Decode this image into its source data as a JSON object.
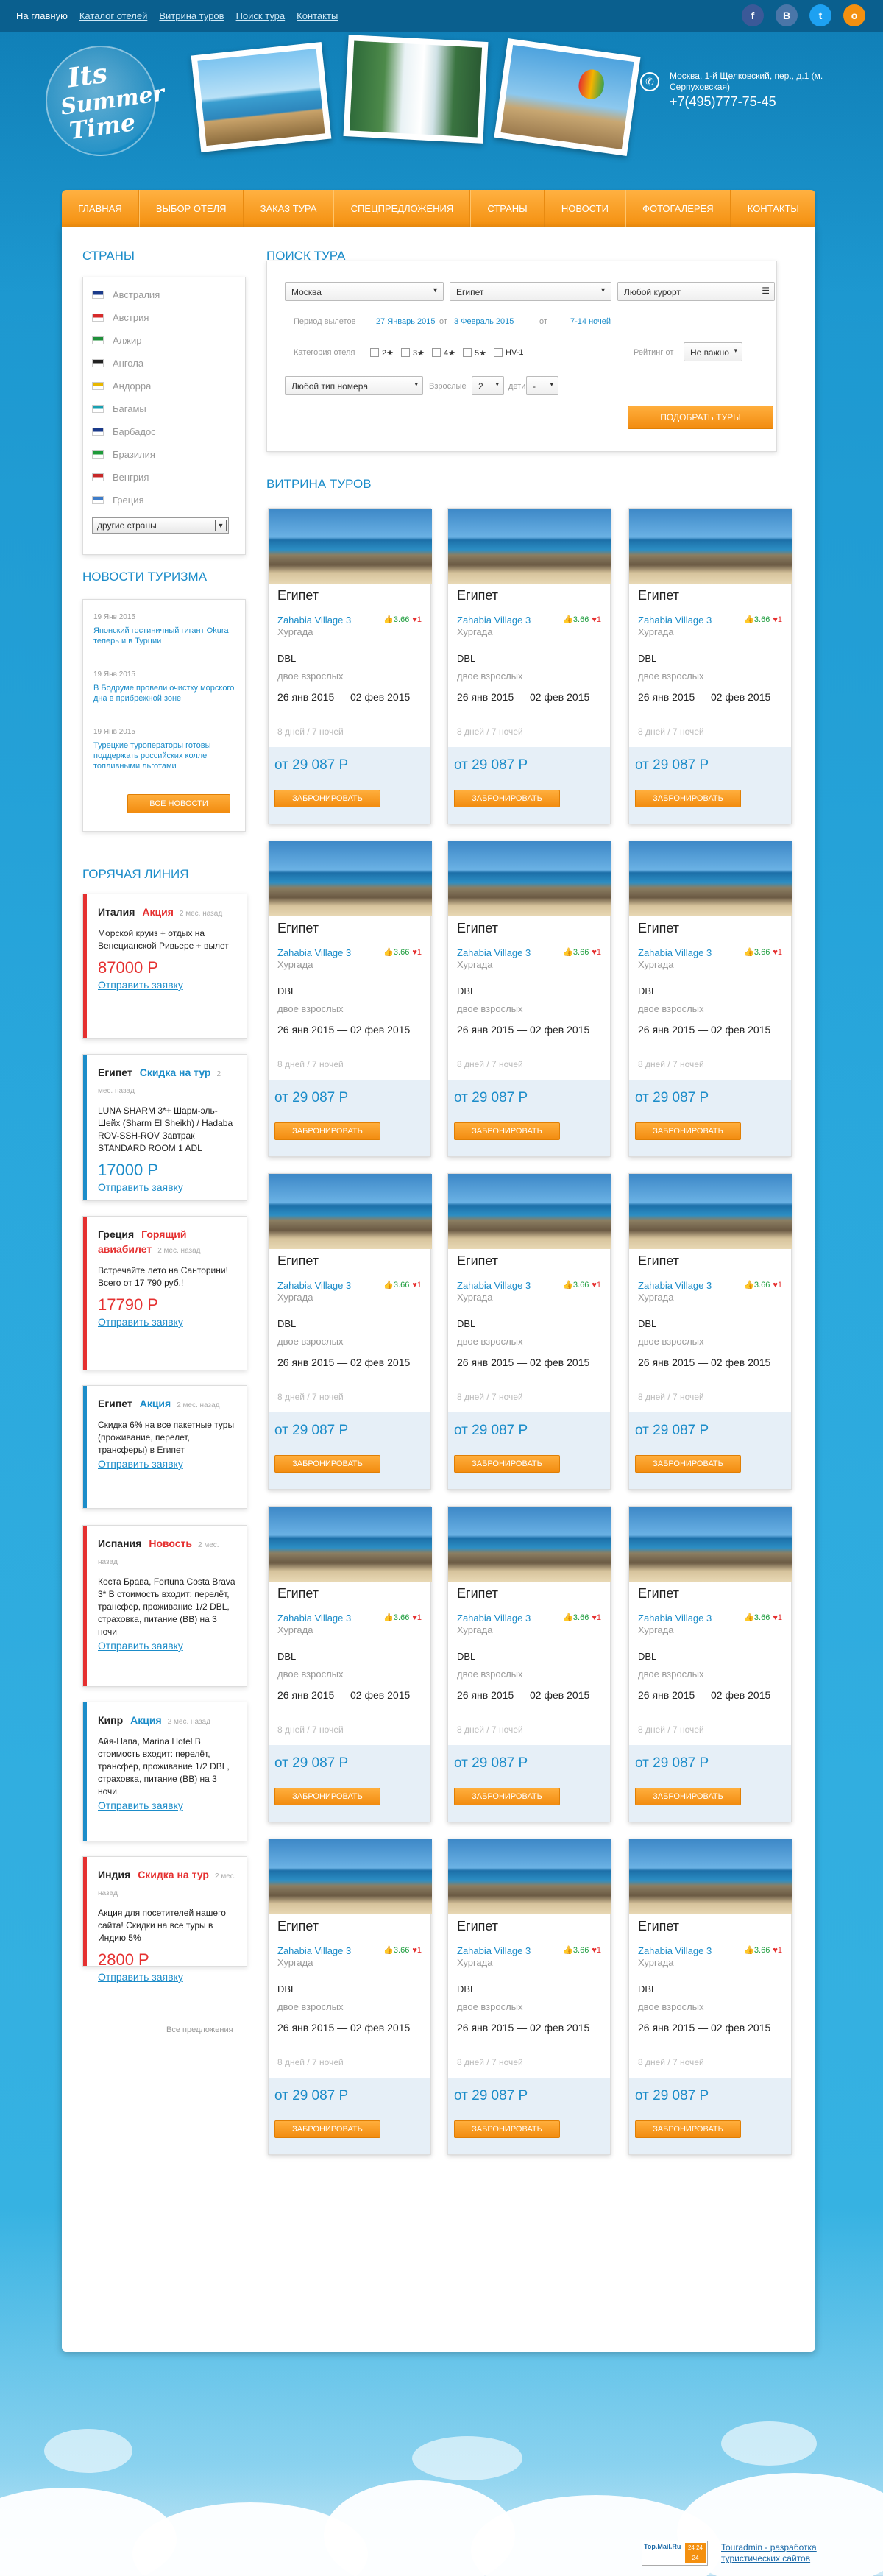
{
  "topnav": [
    "На главную",
    "Каталог отелей",
    "Витрина туров",
    "Поиск тура",
    "Контакты"
  ],
  "social": [
    {
      "label": "f",
      "color": "#3b5998",
      "name": "facebook-icon"
    },
    {
      "label": "В",
      "color": "#4a76a8",
      "name": "vk-icon"
    },
    {
      "label": "t",
      "color": "#1da1f2",
      "name": "twitter-icon"
    },
    {
      "label": "о",
      "color": "#f4900f",
      "name": "odnoklassniki-icon"
    }
  ],
  "logo": {
    "l1": "Its",
    "l2": "Summer",
    "l3": "Time"
  },
  "contact": {
    "address": "Москва, 1-й Щелковский, пер., д.1 (м. Серпуховская)",
    "phone": "+7(495)777-75-45"
  },
  "mainnav": [
    "Главная",
    "Выбор отеля",
    "Заказ тура",
    "Спецпредложения",
    "Страны",
    "Новости",
    "Фотогалерея",
    "Контакты"
  ],
  "countries_title": "Страны",
  "countries": [
    {
      "name": "Австралия",
      "flag": "#1a3a8a"
    },
    {
      "name": "Австрия",
      "flag": "#d62a2a"
    },
    {
      "name": "Алжир",
      "flag": "#1f8f3a"
    },
    {
      "name": "Ангола",
      "flag": "#222222"
    },
    {
      "name": "Андорра",
      "flag": "#e8b700"
    },
    {
      "name": "Багамы",
      "flag": "#18a0b0"
    },
    {
      "name": "Барбадос",
      "flag": "#1a3a8a"
    },
    {
      "name": "Бразилия",
      "flag": "#1f9a3a"
    },
    {
      "name": "Венгрия",
      "flag": "#c62828"
    },
    {
      "name": "Греция",
      "flag": "#3d7cc9"
    }
  ],
  "other_countries": "другие страны",
  "news_title": "Новости туризма",
  "news": [
    {
      "date": "19 Янв 2015",
      "text": "Японский гостиничный гигант Okura теперь и в Турции"
    },
    {
      "date": "19 Янв 2015",
      "text": "В Бодруме провели очистку морского дна в прибрежной зоне"
    },
    {
      "date": "19 Янв 2015",
      "text": "Турецкие туроператоры готовы поддержать российских коллег топливными льготами"
    }
  ],
  "all_news": "Все новости",
  "hotline_title": "Горячая линия",
  "hotline": [
    {
      "country": "Италия",
      "tag": "Акция",
      "tag_color": "#e53030",
      "ago": "2 мес. назад",
      "text": "Морской круиз + отдых на Венецианской Ривьере + вылет",
      "price": "87000 Р",
      "price_color": "#e53030",
      "bar": "#e53030"
    },
    {
      "country": "Египет",
      "tag": "Скидка на тур",
      "tag_color": "#1b8cc9",
      "ago": "2 мес. назад",
      "text": "LUNA SHARM 3*+ Шарм-эль-Шейх (Sharm El Sheikh) / Hadaba ROV-SSH-ROV Завтрак STANDARD ROOM 1 ADL",
      "price": "17000 Р",
      "price_color": "#1b8cc9",
      "bar": "#1b8cc9"
    },
    {
      "country": "Греция",
      "tag": "Горящий авиабилет",
      "tag_color": "#e53030",
      "ago": "2 мес. назад",
      "text": "Встречайте лето на Санторини! Всего от 17 790 руб.!",
      "price": "17790 Р",
      "price_color": "#e53030",
      "bar": "#e53030"
    },
    {
      "country": "Египет",
      "tag": "Акция",
      "tag_color": "#1b8cc9",
      "ago": "2 мес. назад",
      "text": "Скидка 6% на все пакетные туры (проживание, перелет, трансферы) в Египет",
      "price": "",
      "price_color": "#1b8cc9",
      "bar": "#1b8cc9"
    },
    {
      "country": "Испания",
      "tag": "Новость",
      "tag_color": "#e53030",
      "ago": "2 мес. назад",
      "text": "Коста Брава, Fortuna Costa Brava 3* В стоимость входит: перелёт, трансфер, проживание 1/2 DBL, страховка, питание (BB) на 3 ночи",
      "price": "",
      "price_color": "#e53030",
      "bar": "#e53030"
    },
    {
      "country": "Кипр",
      "tag": "Акция",
      "tag_color": "#1b8cc9",
      "ago": "2 мес. назад",
      "text": "Айя-Напа, Marina Hotel В стоимость входит: перелёт, трансфер, проживание 1/2 DBL, страховка, питание (BB) на 3 ночи",
      "price": "",
      "price_color": "#1b8cc9",
      "bar": "#1b8cc9"
    },
    {
      "country": "Индия",
      "tag": "Скидка на тур",
      "tag_color": "#e53030",
      "ago": "2 мес. назад",
      "text": "Акция для посетителей нашего сайта! Скидки на все туры в Индию 5%",
      "price": "2800 Р",
      "price_color": "#e53030",
      "bar": "#e53030"
    }
  ],
  "send_request": "Отправить заявку",
  "all_offers": "Все предложения",
  "search": {
    "title": "Поиск тура",
    "city": "Москва",
    "country": "Египет",
    "resort": "Любой курорт",
    "period_label": "Период вылетов",
    "date_from": "27 Январь 2015",
    "from_label": "от",
    "date_to": "3 Февраль 2015",
    "to_label": "от",
    "nights": "7-14 ночей",
    "category_label": "Категория отеля",
    "stars": [
      "2★",
      "3★",
      "4★",
      "5★",
      "HV-1"
    ],
    "rating_label": "Рейтинг от",
    "rating": "Не важно",
    "room": "Любой тип номера",
    "adults_label": "Взрослые",
    "adults": "2",
    "kids_label": "дети",
    "kids": "-",
    "button": "Подобрать туры"
  },
  "showcase_title": "Витрина туров",
  "tour": {
    "dest": "Египет",
    "hotel": "Zahabia Village 3",
    "rating": "3.66",
    "hearts": "1",
    "city": "Хургада",
    "room": "DBL",
    "pax": "двое взрослых",
    "dates": "26 янв 2015 — 02 фев 2015",
    "nights": "8 дней / 7 ночей",
    "price": "от 29 087 Р",
    "button": "Забронировать"
  },
  "footer": {
    "counter_left": "Top.Mail.Ru",
    "counter_right": "24 24 24",
    "link": "Touradmin - разработка туристических сайтов"
  }
}
